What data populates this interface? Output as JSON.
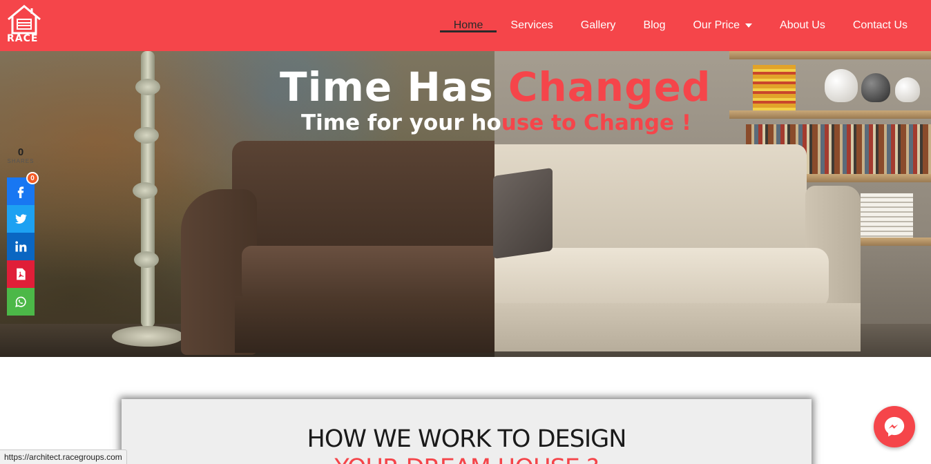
{
  "brand": {
    "name": "RACE",
    "color": "#f5454a"
  },
  "nav": {
    "items": [
      {
        "label": "Home",
        "active": true
      },
      {
        "label": "Services"
      },
      {
        "label": "Gallery"
      },
      {
        "label": "Blog"
      },
      {
        "label": "Our Price",
        "dropdown": true
      },
      {
        "label": "About Us"
      },
      {
        "label": "Contact Us"
      }
    ]
  },
  "hero": {
    "title_white": "Time Has ",
    "title_accent": "Changed",
    "subtitle_white": "Time for your ho",
    "subtitle_accent": "use to Change !"
  },
  "share": {
    "count": "0",
    "label": "SHARES",
    "facebook_badge": "0",
    "buttons": [
      "facebook-icon",
      "twitter-icon",
      "linkedin-icon",
      "pdf-icon",
      "whatsapp-icon"
    ]
  },
  "section": {
    "title": "HOW WE WORK TO DESIGN",
    "subtitle": "YOUR DREAM HOUSE ?"
  },
  "messenger": {
    "icon": "messenger-icon"
  },
  "status_bar": {
    "url": "https://architect.racegroups.com"
  }
}
